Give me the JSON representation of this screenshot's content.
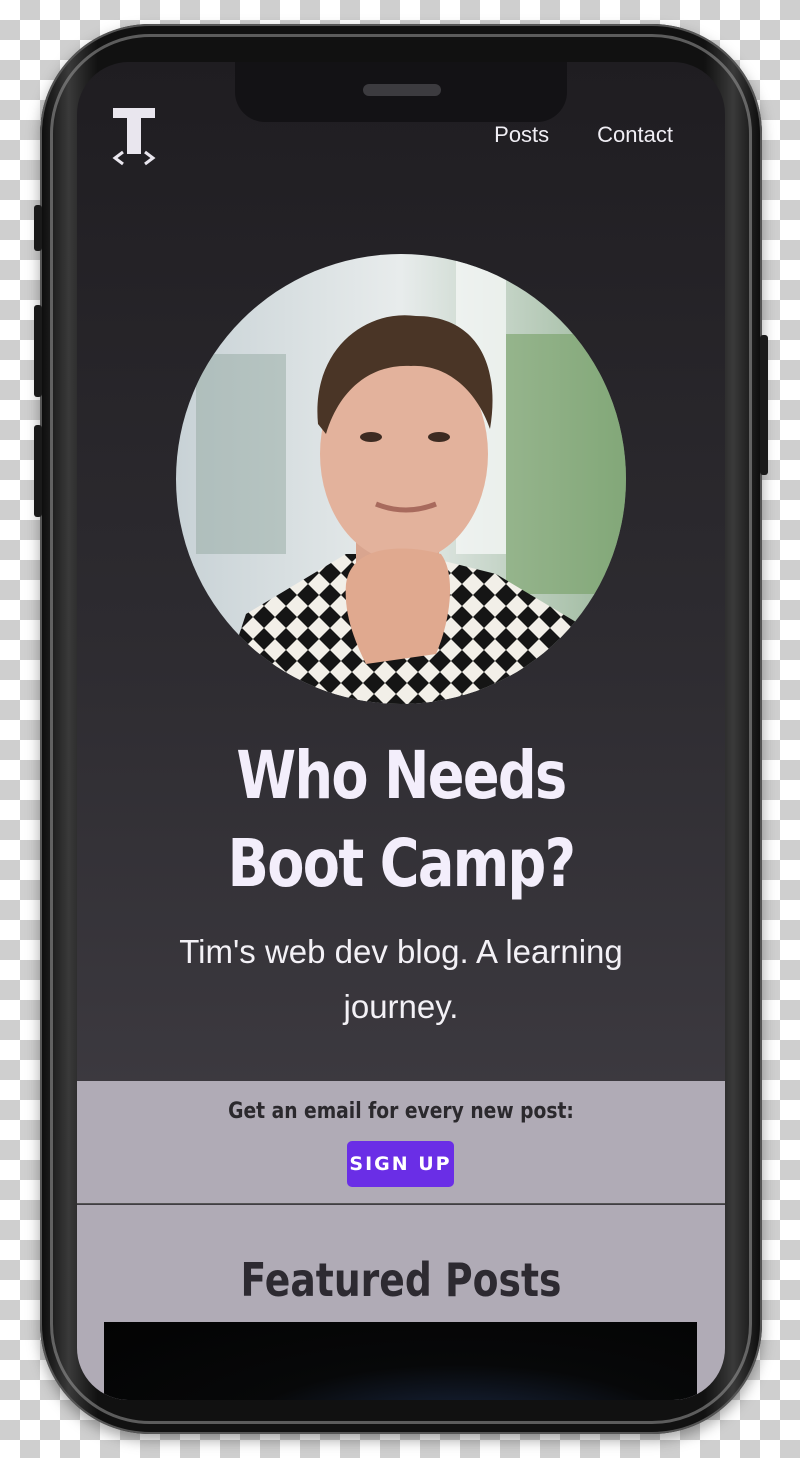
{
  "header": {
    "logo_alt": "T",
    "nav": [
      {
        "label": "Posts"
      },
      {
        "label": "Contact"
      }
    ]
  },
  "hero": {
    "title": "Who Needs Boot Camp?",
    "subtitle": "Tim's web dev blog. A learning journey."
  },
  "signup": {
    "prompt": "Get an email for every new post:",
    "button_label": "SIGN UP"
  },
  "featured": {
    "title": "Featured Posts"
  },
  "colors": {
    "accent": "#6a2ee6",
    "band": "#b0abb6",
    "hero_text": "#f3eefb"
  },
  "icons": [
    "logo-icon",
    "profile-photo"
  ]
}
